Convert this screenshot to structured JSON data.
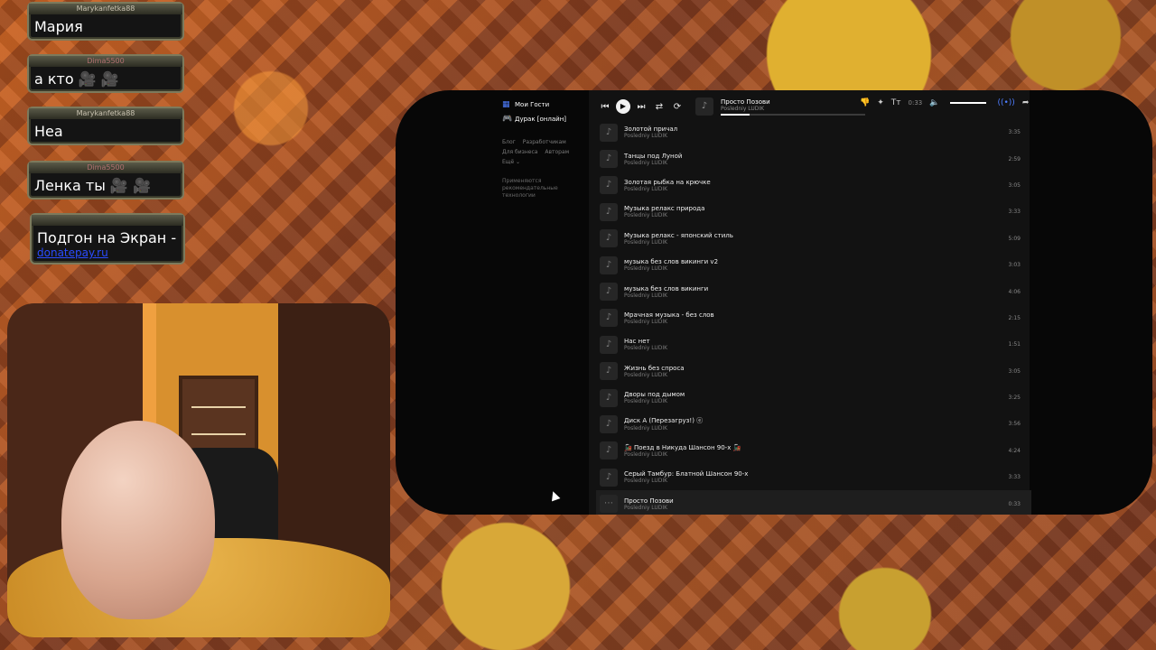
{
  "chat": [
    {
      "user": "Marykanfetka88",
      "message": "Мария"
    },
    {
      "user": "Dima5500",
      "message": "а кто 🎥 🎥"
    },
    {
      "user": "Marykanfetka88",
      "message": "Неа"
    },
    {
      "user": "Dima5500",
      "message": "Ленка ты 🎥 🎥"
    },
    {
      "user": "",
      "message": "Подгон на Экран -",
      "link": "donatepay.ru"
    }
  ],
  "sidebar": {
    "items": [
      {
        "icon": "grid-icon",
        "label": "Мои Гости"
      },
      {
        "icon": "gamepad-icon",
        "label": "Дурак [онлайн]"
      }
    ],
    "links_row1": [
      "Блог",
      "Разработчикам"
    ],
    "links_row2": [
      "Для бизнеса",
      "Авторам"
    ],
    "more": "Ещё ⌄",
    "recommend": "Применяются рекомендательные технологии"
  },
  "player": {
    "now_title": "Просто Позови",
    "now_artist": "Posledniy LUDIK",
    "time": "0:33",
    "progress": 0.2
  },
  "tracks": [
    {
      "title": "Золотой причал",
      "artist": "Posledniy LUDIK",
      "duration": "3:35"
    },
    {
      "title": "Танцы под Луной",
      "artist": "Posledniy LUDIK",
      "duration": "2:59"
    },
    {
      "title": "Золотая рыбка на крючке",
      "artist": "Posledniy LUDIK",
      "duration": "3:05"
    },
    {
      "title": "Музыка релакс природа",
      "artist": "Posledniy LUDIK",
      "duration": "3:33"
    },
    {
      "title": "Музыка релакс - японский стиль",
      "artist": "Posledniy LUDIK",
      "duration": "5:09"
    },
    {
      "title": "музыка без слов викинги v2",
      "artist": "Posledniy LUDIK",
      "duration": "3:03"
    },
    {
      "title": "музыка без слов викинги",
      "artist": "Posledniy LUDIK",
      "duration": "4:06"
    },
    {
      "title": "Мрачная музыка - без слов",
      "artist": "Posledniy LUDIK",
      "duration": "2:15"
    },
    {
      "title": "Нас нет",
      "artist": "Posledniy LUDIK",
      "duration": "1:51"
    },
    {
      "title": "Жизнь без спроса",
      "artist": "Posledniy LUDIK",
      "duration": "3:05"
    },
    {
      "title": "Дворы под дымом",
      "artist": "Posledniy LUDIK",
      "duration": "3:25"
    },
    {
      "title": "Диск А (Перезагруз!) ⓔ",
      "artist": "Posledniy LUDIK",
      "duration": "3:56"
    },
    {
      "title": "🚂 Поезд в Никуда Шансон 90-х 🚂",
      "artist": "Posledniy LUDIK",
      "duration": "4:24"
    },
    {
      "title": "Серый Тамбур: Блатной Шансон 90-х",
      "artist": "Posledniy LUDIK",
      "duration": "3:33"
    },
    {
      "title": "Просто Позови",
      "artist": "Posledniy LUDIK",
      "duration": "0:33",
      "active": true
    }
  ]
}
